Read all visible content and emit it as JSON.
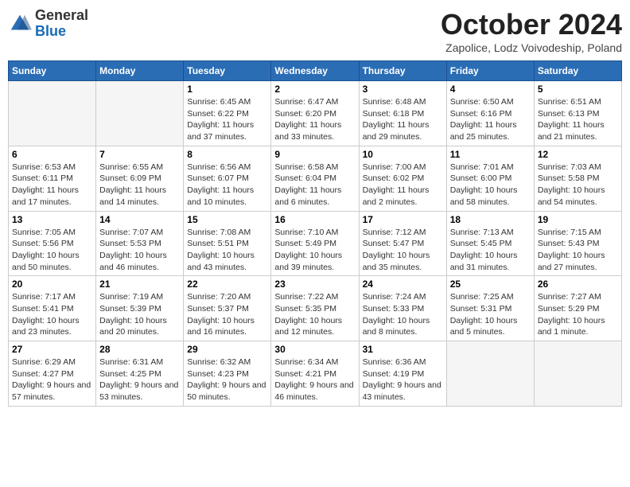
{
  "logo": {
    "general": "General",
    "blue": "Blue"
  },
  "title": "October 2024",
  "subtitle": "Zapolice, Lodz Voivodeship, Poland",
  "days_header": [
    "Sunday",
    "Monday",
    "Tuesday",
    "Wednesday",
    "Thursday",
    "Friday",
    "Saturday"
  ],
  "weeks": [
    [
      {
        "day": "",
        "empty": true
      },
      {
        "day": "",
        "empty": true
      },
      {
        "day": "1",
        "sunrise": "Sunrise: 6:45 AM",
        "sunset": "Sunset: 6:22 PM",
        "daylight": "Daylight: 11 hours and 37 minutes."
      },
      {
        "day": "2",
        "sunrise": "Sunrise: 6:47 AM",
        "sunset": "Sunset: 6:20 PM",
        "daylight": "Daylight: 11 hours and 33 minutes."
      },
      {
        "day": "3",
        "sunrise": "Sunrise: 6:48 AM",
        "sunset": "Sunset: 6:18 PM",
        "daylight": "Daylight: 11 hours and 29 minutes."
      },
      {
        "day": "4",
        "sunrise": "Sunrise: 6:50 AM",
        "sunset": "Sunset: 6:16 PM",
        "daylight": "Daylight: 11 hours and 25 minutes."
      },
      {
        "day": "5",
        "sunrise": "Sunrise: 6:51 AM",
        "sunset": "Sunset: 6:13 PM",
        "daylight": "Daylight: 11 hours and 21 minutes."
      }
    ],
    [
      {
        "day": "6",
        "sunrise": "Sunrise: 6:53 AM",
        "sunset": "Sunset: 6:11 PM",
        "daylight": "Daylight: 11 hours and 17 minutes."
      },
      {
        "day": "7",
        "sunrise": "Sunrise: 6:55 AM",
        "sunset": "Sunset: 6:09 PM",
        "daylight": "Daylight: 11 hours and 14 minutes."
      },
      {
        "day": "8",
        "sunrise": "Sunrise: 6:56 AM",
        "sunset": "Sunset: 6:07 PM",
        "daylight": "Daylight: 11 hours and 10 minutes."
      },
      {
        "day": "9",
        "sunrise": "Sunrise: 6:58 AM",
        "sunset": "Sunset: 6:04 PM",
        "daylight": "Daylight: 11 hours and 6 minutes."
      },
      {
        "day": "10",
        "sunrise": "Sunrise: 7:00 AM",
        "sunset": "Sunset: 6:02 PM",
        "daylight": "Daylight: 11 hours and 2 minutes."
      },
      {
        "day": "11",
        "sunrise": "Sunrise: 7:01 AM",
        "sunset": "Sunset: 6:00 PM",
        "daylight": "Daylight: 10 hours and 58 minutes."
      },
      {
        "day": "12",
        "sunrise": "Sunrise: 7:03 AM",
        "sunset": "Sunset: 5:58 PM",
        "daylight": "Daylight: 10 hours and 54 minutes."
      }
    ],
    [
      {
        "day": "13",
        "sunrise": "Sunrise: 7:05 AM",
        "sunset": "Sunset: 5:56 PM",
        "daylight": "Daylight: 10 hours and 50 minutes."
      },
      {
        "day": "14",
        "sunrise": "Sunrise: 7:07 AM",
        "sunset": "Sunset: 5:53 PM",
        "daylight": "Daylight: 10 hours and 46 minutes."
      },
      {
        "day": "15",
        "sunrise": "Sunrise: 7:08 AM",
        "sunset": "Sunset: 5:51 PM",
        "daylight": "Daylight: 10 hours and 43 minutes."
      },
      {
        "day": "16",
        "sunrise": "Sunrise: 7:10 AM",
        "sunset": "Sunset: 5:49 PM",
        "daylight": "Daylight: 10 hours and 39 minutes."
      },
      {
        "day": "17",
        "sunrise": "Sunrise: 7:12 AM",
        "sunset": "Sunset: 5:47 PM",
        "daylight": "Daylight: 10 hours and 35 minutes."
      },
      {
        "day": "18",
        "sunrise": "Sunrise: 7:13 AM",
        "sunset": "Sunset: 5:45 PM",
        "daylight": "Daylight: 10 hours and 31 minutes."
      },
      {
        "day": "19",
        "sunrise": "Sunrise: 7:15 AM",
        "sunset": "Sunset: 5:43 PM",
        "daylight": "Daylight: 10 hours and 27 minutes."
      }
    ],
    [
      {
        "day": "20",
        "sunrise": "Sunrise: 7:17 AM",
        "sunset": "Sunset: 5:41 PM",
        "daylight": "Daylight: 10 hours and 23 minutes."
      },
      {
        "day": "21",
        "sunrise": "Sunrise: 7:19 AM",
        "sunset": "Sunset: 5:39 PM",
        "daylight": "Daylight: 10 hours and 20 minutes."
      },
      {
        "day": "22",
        "sunrise": "Sunrise: 7:20 AM",
        "sunset": "Sunset: 5:37 PM",
        "daylight": "Daylight: 10 hours and 16 minutes."
      },
      {
        "day": "23",
        "sunrise": "Sunrise: 7:22 AM",
        "sunset": "Sunset: 5:35 PM",
        "daylight": "Daylight: 10 hours and 12 minutes."
      },
      {
        "day": "24",
        "sunrise": "Sunrise: 7:24 AM",
        "sunset": "Sunset: 5:33 PM",
        "daylight": "Daylight: 10 hours and 8 minutes."
      },
      {
        "day": "25",
        "sunrise": "Sunrise: 7:25 AM",
        "sunset": "Sunset: 5:31 PM",
        "daylight": "Daylight: 10 hours and 5 minutes."
      },
      {
        "day": "26",
        "sunrise": "Sunrise: 7:27 AM",
        "sunset": "Sunset: 5:29 PM",
        "daylight": "Daylight: 10 hours and 1 minute."
      }
    ],
    [
      {
        "day": "27",
        "sunrise": "Sunrise: 6:29 AM",
        "sunset": "Sunset: 4:27 PM",
        "daylight": "Daylight: 9 hours and 57 minutes."
      },
      {
        "day": "28",
        "sunrise": "Sunrise: 6:31 AM",
        "sunset": "Sunset: 4:25 PM",
        "daylight": "Daylight: 9 hours and 53 minutes."
      },
      {
        "day": "29",
        "sunrise": "Sunrise: 6:32 AM",
        "sunset": "Sunset: 4:23 PM",
        "daylight": "Daylight: 9 hours and 50 minutes."
      },
      {
        "day": "30",
        "sunrise": "Sunrise: 6:34 AM",
        "sunset": "Sunset: 4:21 PM",
        "daylight": "Daylight: 9 hours and 46 minutes."
      },
      {
        "day": "31",
        "sunrise": "Sunrise: 6:36 AM",
        "sunset": "Sunset: 4:19 PM",
        "daylight": "Daylight: 9 hours and 43 minutes."
      },
      {
        "day": "",
        "empty": true
      },
      {
        "day": "",
        "empty": true
      }
    ]
  ]
}
